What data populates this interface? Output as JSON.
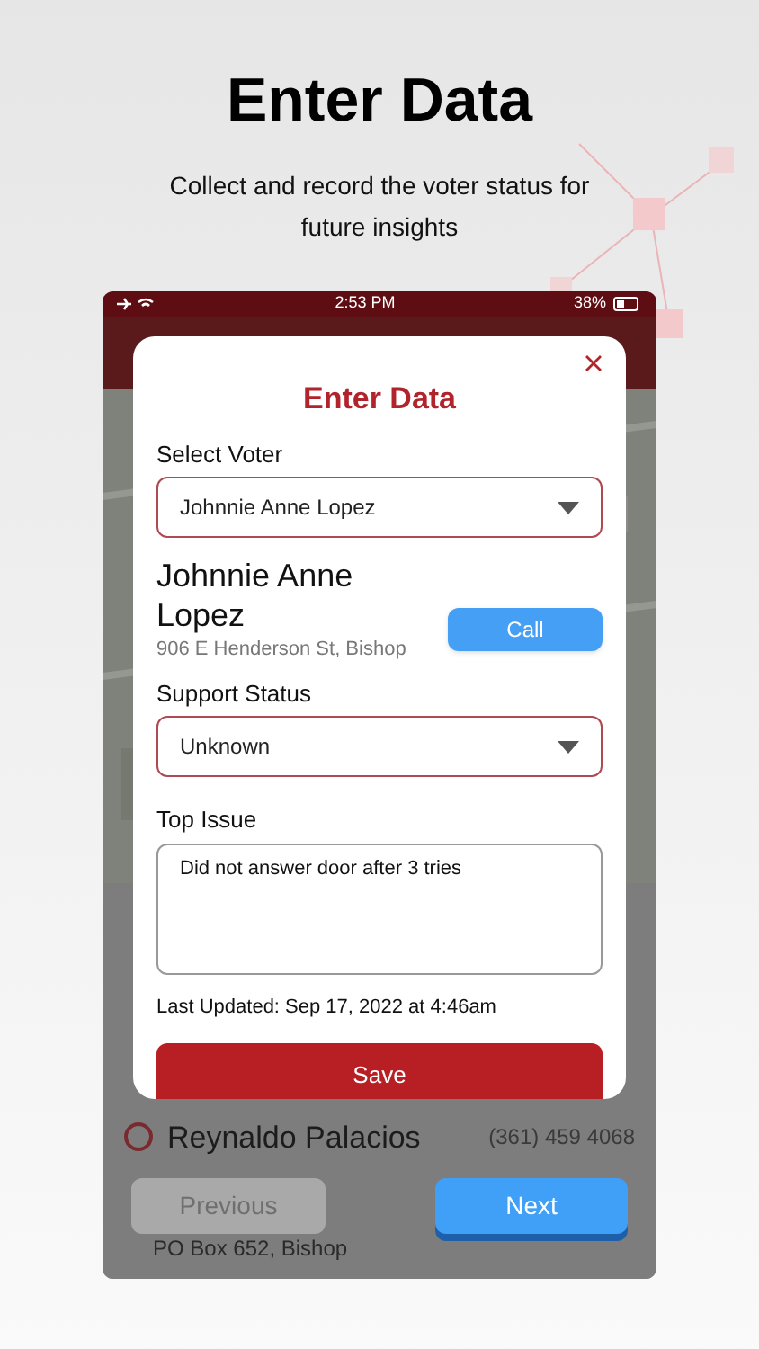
{
  "page": {
    "title": "Enter Data",
    "subtitle": "Collect and record the voter status for future insights"
  },
  "status_bar": {
    "time": "2:53 PM",
    "battery": "38%"
  },
  "background_list": [
    {
      "name": "Reynaldo Palacios",
      "phone": "(361) 459 4068",
      "address": "PO Box 652, Bishop"
    }
  ],
  "modal": {
    "title": "Enter Data",
    "voter_label": "Select Voter",
    "voter_value": "Johnnie Anne Lopez",
    "voter_name": "Johnnie Anne Lopez",
    "voter_address": "906 E Henderson St, Bishop",
    "call_button": "Call",
    "status_label": "Support Status",
    "status_value": "Unknown",
    "issue_label": "Top Issue",
    "issue_value": "Did not answer door after 3 tries",
    "last_updated": "Last Updated: Sep 17, 2022 at 4:46am",
    "save_button": "Save"
  },
  "nav_buttons": [
    {
      "label": "Previous",
      "disabled": true
    },
    {
      "label": "Next",
      "disabled": false
    }
  ]
}
